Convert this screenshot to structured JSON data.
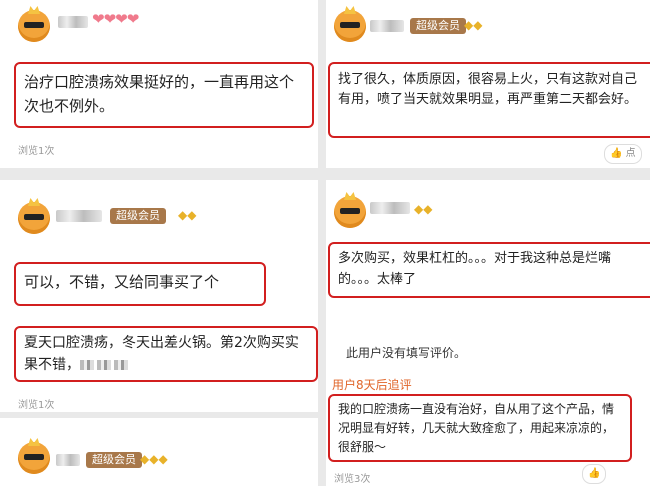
{
  "top_left": {
    "review": "治疗口腔溃疡效果挺好的，一直再用这个次也不例外。",
    "hearts": "❤❤❤❤",
    "views": "浏览1次"
  },
  "top_right": {
    "badge": "超级会员",
    "gems": "◆◆",
    "review": "找了很久，体质原因，很容易上火，只有这款对自己有用，喷了当天就效果明显，再严重第二天都会好。",
    "like": "点"
  },
  "mid_left": {
    "badge": "超级会员",
    "gems": "◆◆",
    "review1": "可以，不错，又给同事买了个",
    "review2": "夏天口腔溃疡，冬天出差火锅。第2次购买实果不错，",
    "views": "浏览1次"
  },
  "mid_right": {
    "gems": "◆◆",
    "review": "多次购买，效果杠杠的。。。对于我这种总是烂嘴的。。。太棒了",
    "no_review": "此用户没有填写评价。",
    "follow_up_label": "用户8天后追评",
    "follow_up": "我的口腔溃疡一直没有治好，自从用了这个产品，情况明显有好转，几天就大致痊愈了，用起来凉凉的，很舒服～",
    "views": "浏览3次"
  },
  "bottom_left": {
    "badge": "超级会员",
    "gems": "◆◆◆"
  }
}
